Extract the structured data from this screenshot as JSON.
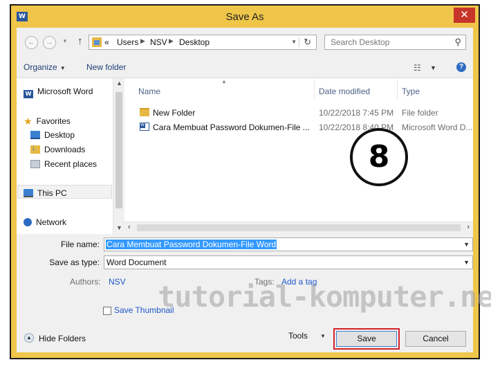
{
  "window": {
    "title": "Save As",
    "app_icon": "word-icon",
    "close_label": "✕"
  },
  "address": {
    "overflow": "«",
    "crumbs": [
      "Users",
      "NSV",
      "Desktop"
    ],
    "search_placeholder": "Search Desktop"
  },
  "toolbar": {
    "organize": "Organize",
    "new_folder": "New folder",
    "help": "?"
  },
  "nav": {
    "items": [
      {
        "label": "Microsoft Word",
        "icon": "word-icon"
      },
      {
        "label": "Favorites",
        "icon": "star-icon"
      },
      {
        "label": "Desktop",
        "icon": "desktop-icon"
      },
      {
        "label": "Downloads",
        "icon": "downloads-icon"
      },
      {
        "label": "Recent places",
        "icon": "recent-places-icon"
      },
      {
        "label": "This PC",
        "icon": "computer-icon"
      },
      {
        "label": "Network",
        "icon": "network-icon"
      }
    ]
  },
  "files": {
    "columns": [
      "Name",
      "Date modified",
      "Type"
    ],
    "rows": [
      {
        "name": "New Folder",
        "date": "10/22/2018 7:45 PM",
        "type": "File folder",
        "icon": "folder-icon"
      },
      {
        "name": "Cara Membuat Password Dokumen-File ...",
        "date": "10/22/2018 8:40 PM",
        "type": "Microsoft Word D...",
        "icon": "word-document-icon"
      }
    ]
  },
  "annotation": {
    "number": "8"
  },
  "form": {
    "file_name_label": "File name:",
    "file_name_value": "Cara Membuat Password Dokumen-File Word",
    "save_type_label": "Save as type:",
    "save_type_value": "Word Document",
    "authors_label": "Authors:",
    "authors_value": "NSV",
    "tags_label": "Tags:",
    "tags_value": "Add a tag",
    "thumbnail_label": "Save Thumbnail"
  },
  "footer": {
    "hide_folders": "Hide Folders",
    "tools": "Tools",
    "save": "Save",
    "cancel": "Cancel"
  },
  "watermark": "tutorial-komputer.net",
  "colors": {
    "titlebar": "#f0c64a",
    "close": "#c7342a",
    "highlight": "#3399ff",
    "save_outline": "#d4202a"
  }
}
